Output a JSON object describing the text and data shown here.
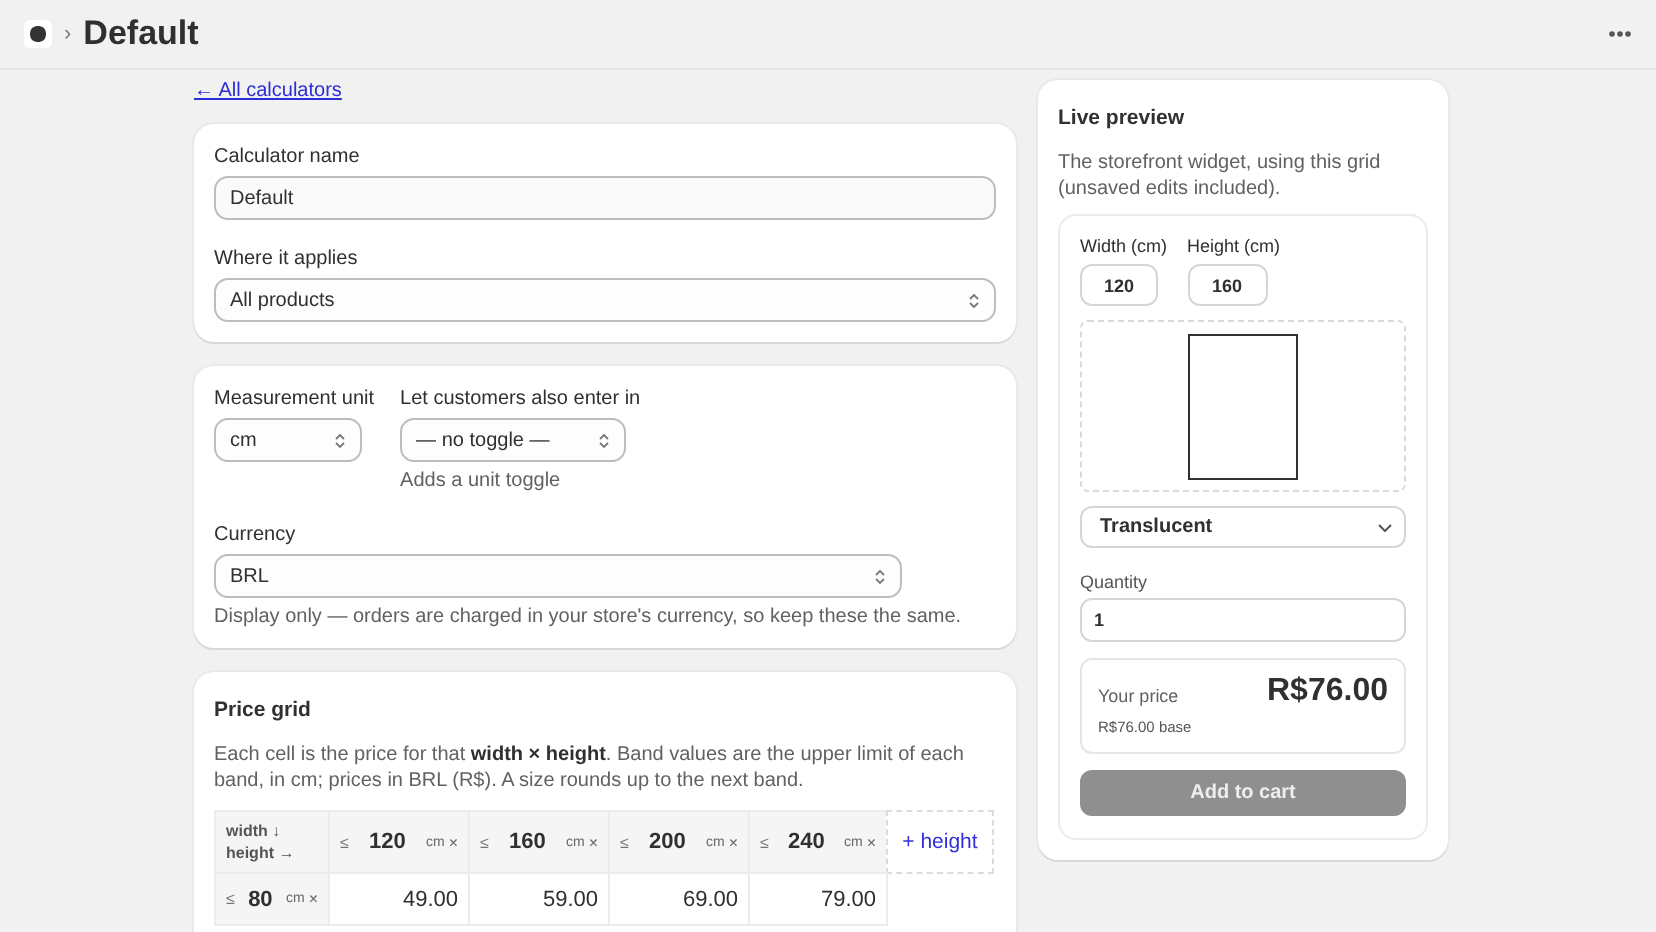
{
  "header": {
    "separator": "›",
    "title": "Default"
  },
  "back_link": "← All calculators",
  "general": {
    "name_label": "Calculator name",
    "name_value": "Default",
    "applies_label": "Where it applies",
    "applies_value": "All products"
  },
  "units": {
    "unit_label": "Measurement unit",
    "unit_value": "cm",
    "alt_label": "Let customers also enter in",
    "alt_value": "— no toggle —",
    "alt_help": "Adds a unit toggle",
    "currency_label": "Currency",
    "currency_value": "BRL",
    "currency_help": "Display only — orders are charged in your store's currency, so keep these the same."
  },
  "price_grid": {
    "title": "Price grid",
    "description": "Each cell is the price for that **width × height**. Band values are the upper limit of each band, in cm; prices in BRL (R$). A size rounds up to the next band.",
    "corner": [
      "width ↓",
      "height →"
    ],
    "columns": [
      {
        "prefix": "≤",
        "value": "120",
        "unit": "cm",
        "remove": "×"
      },
      {
        "prefix": "≤",
        "value": "160",
        "unit": "cm",
        "remove": "×"
      },
      {
        "prefix": "≤",
        "value": "200",
        "unit": "cm",
        "remove": "×"
      },
      {
        "prefix": "≤",
        "value": "240",
        "unit": "cm",
        "remove": "×"
      }
    ],
    "add_column": "+ height",
    "rows": [
      {
        "prefix": "≤",
        "value": "80",
        "unit": "cm",
        "remove": "×",
        "cells": [
          "49.00",
          "59.00",
          "69.00",
          "79.00"
        ]
      }
    ]
  },
  "preview": {
    "title": "Live preview",
    "description": "The storefront widget, using this grid (unsaved edits included).",
    "width_label": "Width (cm)",
    "width_value": "120",
    "height_label": "Height (cm)",
    "height_value": "160",
    "finish": "Translucent",
    "quantity_label": "Quantity",
    "quantity_value": "1",
    "price_label": "Your price",
    "price": "R$76.00",
    "base": "R$76.00 base",
    "add_to_cart": {
      "label": "Add to cart",
      "disabled": true
    }
  }
}
